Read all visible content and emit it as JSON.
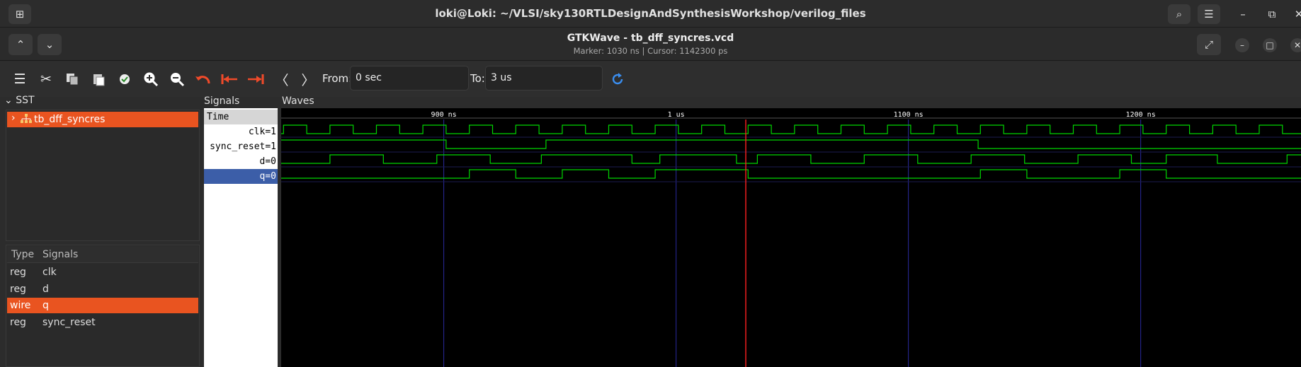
{
  "terminal": {
    "title": "loki@Loki: ~/VLSI/sky130RTLDesignAndSynthesisWorkshop/verilog_files"
  },
  "app": {
    "title": "GTKWave - tb_dff_syncres.vcd",
    "marker_text": "Marker: 1030 ns  |  Cursor: 1142300 ps"
  },
  "toolbar": {
    "from_label": "From:",
    "from_value": "0 sec",
    "to_label": "To:",
    "to_value": "3 us"
  },
  "sst": {
    "header": "SST",
    "tree": [
      {
        "label": "tb_dff_syncres",
        "selected": true
      }
    ],
    "columns": [
      "Type",
      "Signals"
    ],
    "rows": [
      {
        "type": "reg",
        "signal": "clk"
      },
      {
        "type": "reg",
        "signal": "d"
      },
      {
        "type": "wire",
        "signal": "q"
      },
      {
        "type": "reg",
        "signal": "sync_reset"
      }
    ]
  },
  "signals": {
    "header": "Signals",
    "time_label": "Time",
    "list": [
      "clk=1",
      "sync_reset=1",
      "d=0",
      "q=0"
    ]
  },
  "waves": {
    "header": "Waves",
    "time_labels": [
      {
        "t": 900,
        "label": "900 ns"
      },
      {
        "t": 1000,
        "label": "1 us"
      },
      {
        "t": 1100,
        "label": "1100 ns"
      },
      {
        "t": 1200,
        "label": "1200 ns"
      }
    ],
    "view_start_ns": 830,
    "view_end_ns": 1269,
    "marker_ns": 1030,
    "clk_period_ns": 20,
    "clk_first_rise_ns": 831,
    "traces": [
      {
        "name": "sync_reset",
        "initial": 1,
        "edges": [
          901,
          944,
          1130
        ]
      },
      {
        "name": "d",
        "initial": 0,
        "edges": [
          851,
          874,
          897,
          920,
          942,
          981,
          993,
          1026,
          1035,
          1058,
          1081,
          1104,
          1127,
          1150,
          1173,
          1196,
          1211,
          1233,
          1263
        ]
      },
      {
        "name": "q",
        "initial": 0,
        "edges": [
          911,
          931,
          951,
          971,
          991,
          1031,
          1131,
          1151,
          1191,
          1211
        ]
      }
    ],
    "colors": {
      "trace": "#00d600",
      "grid": "#2a2aa0",
      "marker": "#ff2020",
      "ruler_text": "#ffffff"
    }
  }
}
